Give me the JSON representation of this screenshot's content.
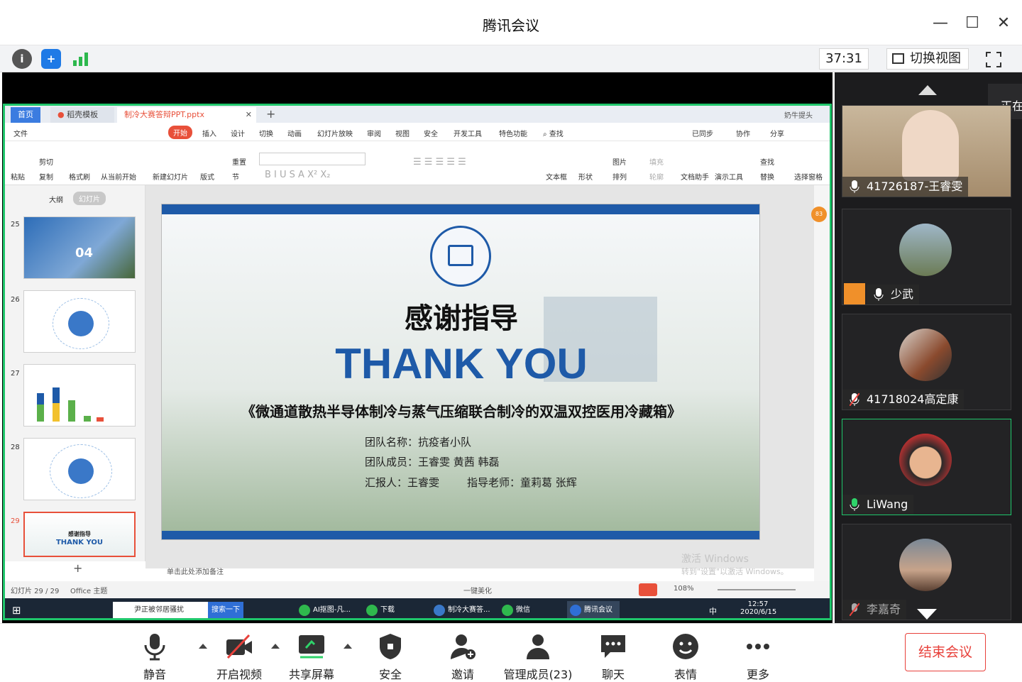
{
  "window": {
    "title": "腾讯会议"
  },
  "infobar": {
    "timer": "37:31",
    "switch_view": "切换视图"
  },
  "wps": {
    "tabs": [
      "首页",
      "稻壳模板",
      "制冷大赛答辩PPT.pptx"
    ],
    "user": "奶牛提头",
    "file_menu": "文件",
    "menus": [
      "开始",
      "插入",
      "设计",
      "切换",
      "动画",
      "幻灯片放映",
      "审阅",
      "视图",
      "安全",
      "开发工具",
      "特色功能"
    ],
    "search": "查找",
    "right_actions": [
      "已同步",
      "协作",
      "分享"
    ],
    "ribbon_items": [
      "粘贴",
      "剪切",
      "复制",
      "格式刷",
      "从当前开始",
      "新建幻灯片",
      "版式",
      "重置",
      "节",
      "文本框",
      "形状",
      "图片",
      "排列",
      "填充",
      "轮廓",
      "文档助手",
      "演示工具",
      "查找",
      "替换",
      "选择窗格"
    ],
    "panel_tabs": [
      "大纲",
      "幻灯片"
    ],
    "thumbs": [
      {
        "num": "25",
        "text": "04"
      },
      {
        "num": "26",
        "text": ""
      },
      {
        "num": "27",
        "text": ""
      },
      {
        "num": "28",
        "text": ""
      },
      {
        "num": "29",
        "text": "感谢指导",
        "text2": "THANK YOU"
      }
    ],
    "add_notes": "单击此处添加备注",
    "status": {
      "slide_count": "幻灯片 29 / 29",
      "theme": "Office 主题",
      "beautify": "一键美化",
      "zoom": "108%"
    },
    "activate": {
      "line1": "激活 Windows",
      "line2": "转到\"设置\"以激活 Windows。"
    },
    "badge": "83"
  },
  "slide": {
    "title_cn": "感谢指导",
    "title_en": "THANK YOU",
    "subtitle": "《微通道散热半导体制冷与蒸气压缩联合制冷的双温双控医用冷藏箱》",
    "team_name": "团队名称：抗疫者小队",
    "team_members": "团队成员：王睿雯 黄茜 韩磊",
    "reporter": "汇报人：王睿雯",
    "advisor": "指导老师：童莉葛 张辉"
  },
  "taskbar": {
    "search_text": "尹正被邻居骚扰",
    "search_btn": "搜索一下",
    "apps": [
      "AI抠图-凡...",
      "下载",
      "制冷大赛答...",
      "微信",
      "腾讯会议"
    ],
    "time": "12:57",
    "date": "2020/6/15",
    "ime": "中"
  },
  "participants": [
    {
      "name": "41726187-王睿雯",
      "muted": false,
      "note": "正在"
    },
    {
      "name": "少武",
      "muted": false
    },
    {
      "name": "41718024高定康",
      "muted": true
    },
    {
      "name": "LiWang",
      "muted": false
    },
    {
      "name": "李嘉奇",
      "muted": true
    }
  ],
  "toolbar": {
    "mute": "静音",
    "video": "开启视频",
    "share": "共享屏幕",
    "security": "安全",
    "invite": "邀请",
    "members": "管理成员(23)",
    "chat": "聊天",
    "emoji": "表情",
    "more": "更多",
    "end": "结束会议"
  },
  "colors": {
    "accent_green": "#1fc66b",
    "end_red": "#e8413b",
    "wps_red": "#e8503a",
    "slide_blue": "#1e5aa8"
  }
}
